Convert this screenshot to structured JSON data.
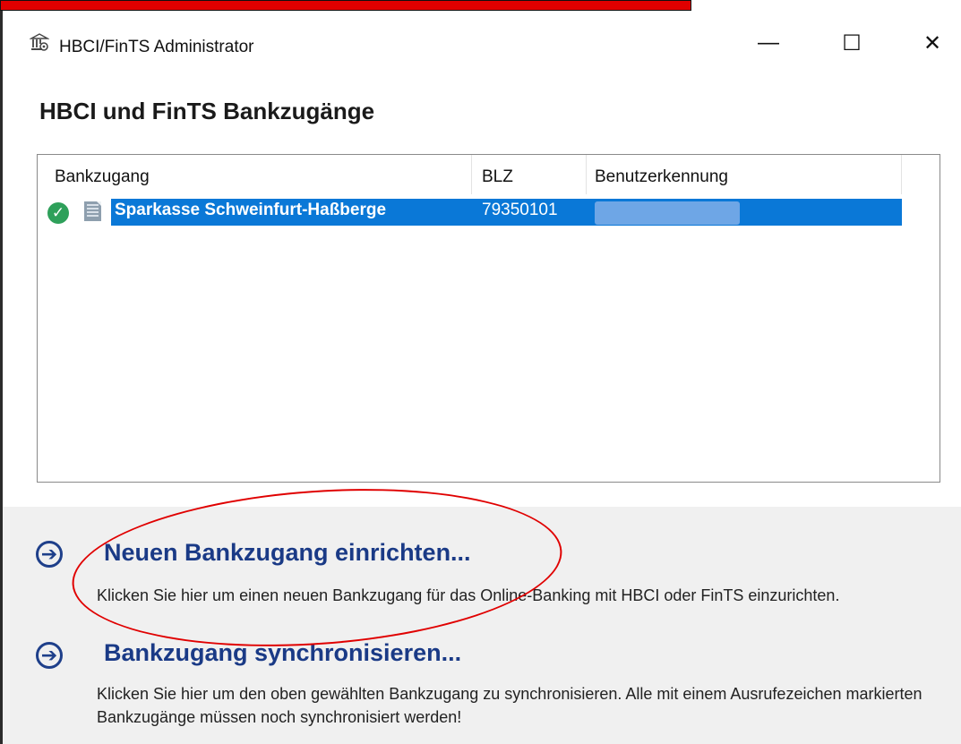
{
  "window": {
    "title": "HBCI/FinTS Administrator",
    "minimize_glyph": "—",
    "maximize_glyph": "☐",
    "close_glyph": "✕"
  },
  "heading": "HBCI und FinTS Bankzugänge",
  "list": {
    "columns": [
      "Bankzugang",
      "BLZ",
      "Benutzerkennung"
    ],
    "rows": [
      {
        "bank": "Sparkasse Schweinfurt-Haßberge",
        "blz": "79350101",
        "status_icon": "check-circle-icon",
        "user_redacted": true
      }
    ]
  },
  "actions": [
    {
      "title": "Neuen Bankzugang einrichten...",
      "desc": "Klicken Sie hier um einen neuen Bankzugang für das Online-Banking mit HBCI oder FinTS einzurichten.",
      "icon": "arrow-circle-icon"
    },
    {
      "title": "Bankzugang synchronisieren...",
      "desc": "Klicken Sie hier um den oben gewählten Bankzugang zu synchronisieren. Alle mit einem Ausrufezeichen markierten Bankzugänge müssen noch synchronisiert werden!",
      "icon": "arrow-circle-icon"
    }
  ],
  "colors": {
    "selection": "#0a78d7",
    "link": "#1a3a86",
    "annotation": "#e00000"
  }
}
